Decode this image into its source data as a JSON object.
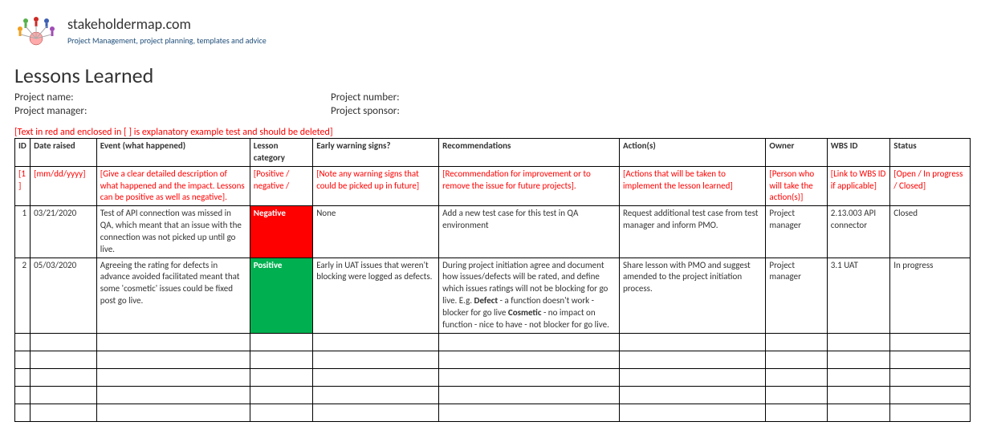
{
  "brand": {
    "name": "stakeholdermap.com",
    "tagline": "Project Management, project planning, templates and advice"
  },
  "title": "Lessons Learned",
  "meta": {
    "project_name_label": "Project name:",
    "project_number_label": "Project number:",
    "project_manager_label": "Project manager:",
    "project_sponsor_label": "Project sponsor:"
  },
  "instruction": "[Text in red and enclosed in [ ] is explanatory example test and should be deleted]",
  "columns": {
    "id": "ID",
    "date": "Date raised",
    "event": "Event (what happened)",
    "category": "Lesson category",
    "early": "Early warning signs?",
    "rec": "Recommendations",
    "action": "Action(s)",
    "owner": "Owner",
    "wbs": "WBS ID",
    "status": "Status"
  },
  "hint_row": {
    "id": "[1]",
    "date": "[mm/dd/yyyy]",
    "event": "[Give a clear detailed description of what happened and the impact. Lessons can be positive as well as negative].",
    "category": "[Positive / negative /",
    "early": "[Note any warning signs that could be picked up in future]",
    "rec": "[Recommendation for improvement or to remove the issue for future projects].",
    "action": "[Actions that will be taken to implement the lesson learned]",
    "owner": "[Person who will take the action(s)]",
    "wbs": "[Link to WBS ID if applicable]",
    "status": "[Open / In progress / Closed]"
  },
  "rows": [
    {
      "id": "1",
      "date": "03/21/2020",
      "event": "Test of API connection was missed in QA, which meant that an issue with the connection was not picked up until go live.",
      "category": "Negative",
      "category_class": "cat-neg",
      "early": "None",
      "rec_plain": "Add a new test case for this test in QA environment",
      "action": "Request additional test case from test manager and inform PMO.",
      "owner": "Project manager",
      "wbs": "2.13.003 API connector",
      "status": "Closed"
    },
    {
      "id": "2",
      "date": "05/03/2020",
      "event": "Agreeing the rating for defects in advance avoided facilitated meant that some 'cosmetic' issues could be fixed post go live.",
      "category": "Positive",
      "category_class": "cat-pos",
      "early": "Early in UAT issues that weren't blocking were logged as defects.",
      "rec_rich": {
        "pre": "During project initiation agree and document how issues/defects will be rated, and define which issues ratings will not be blocking for go live. E.g. ",
        "b1": "Defect",
        "mid": " - a function doesn't work - blocker for go live ",
        "b2": "Cosmetic",
        "post": " - no impact on function - nice to have - not blocker for go live."
      },
      "action": "Share lesson with PMO and suggest amended to the project initiation process.",
      "owner": "Project manager",
      "wbs": "3.1 UAT",
      "status": "In progress"
    }
  ],
  "empty_row_count": 5,
  "chart_data": {
    "type": "table",
    "title": "Lessons Learned",
    "columns": [
      "ID",
      "Date raised",
      "Event (what happened)",
      "Lesson category",
      "Early warning signs?",
      "Recommendations",
      "Action(s)",
      "Owner",
      "WBS ID",
      "Status"
    ],
    "rows": [
      [
        "1",
        "03/21/2020",
        "Test of API connection was missed in QA, which meant that an issue with the connection was not picked up until go live.",
        "Negative",
        "None",
        "Add a new test case for this test in QA environment",
        "Request additional test case from test manager and inform PMO.",
        "Project manager",
        "2.13.003 API connector",
        "Closed"
      ],
      [
        "2",
        "05/03/2020",
        "Agreeing the rating for defects in advance avoided facilitated meant that some 'cosmetic' issues could be fixed post go live.",
        "Positive",
        "Early in UAT issues that weren't blocking were logged as defects.",
        "During project initiation agree and document how issues/defects will be rated, and define which issues ratings will not be blocking for go live. E.g. Defect - a function doesn't work - blocker for go live Cosmetic - no impact on function - nice to have - not blocker for go live.",
        "Share lesson with PMO and suggest amended to the project initiation process.",
        "Project manager",
        "3.1 UAT",
        "In progress"
      ]
    ]
  }
}
